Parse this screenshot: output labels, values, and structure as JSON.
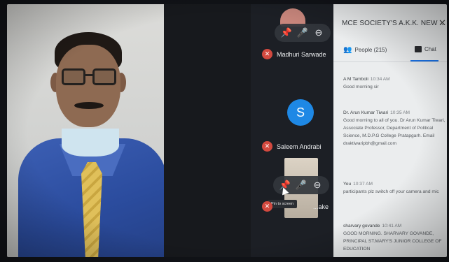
{
  "panel": {
    "title": "MCE SOCIETY'S A.K.K. NEW ...",
    "close_symbol": "✕",
    "tabs": [
      {
        "label": "People (215)",
        "icon": "people-icon"
      },
      {
        "label": "Chat",
        "icon": "chat-icon"
      }
    ],
    "active_tab": "Chat"
  },
  "participants": [
    {
      "name": "Madhuri Sarwade",
      "muted": true
    },
    {
      "name": "Saleem Andrabi",
      "muted": true,
      "avatar_letter": "S",
      "avatar_color": "#1e88e5"
    },
    {
      "name": "...ake",
      "muted": true
    }
  ],
  "tooltip": "Pin to screen",
  "messages": [
    {
      "sender": "A M Tamboli",
      "time": "10:34 AM",
      "text": "Good morning sir"
    },
    {
      "sender": "Dr. Arun Kumar Tiwari",
      "time": "10:35 AM",
      "text": "Good morning to all of you. Dr Arun Kumar Tiwari, Associate Professor, Department of Political Science, M.D.P.G College Pratapgarh. Email draktiwaripbh@gmail.com"
    },
    {
      "sender": "You",
      "time": "10:37 AM",
      "text": "participants plz switch off your camera and mic"
    },
    {
      "sender": "sharvary govande",
      "time": "10:41 AM",
      "text": "GOOD MORNING. SHARVARY GOVANDE, PRINCIPAL ST.MARY'S JUNIOR COLLEGE OF EDUCATION"
    }
  ],
  "colors": {
    "accent": "#1a73e8",
    "mic_off": "#d3493f"
  }
}
